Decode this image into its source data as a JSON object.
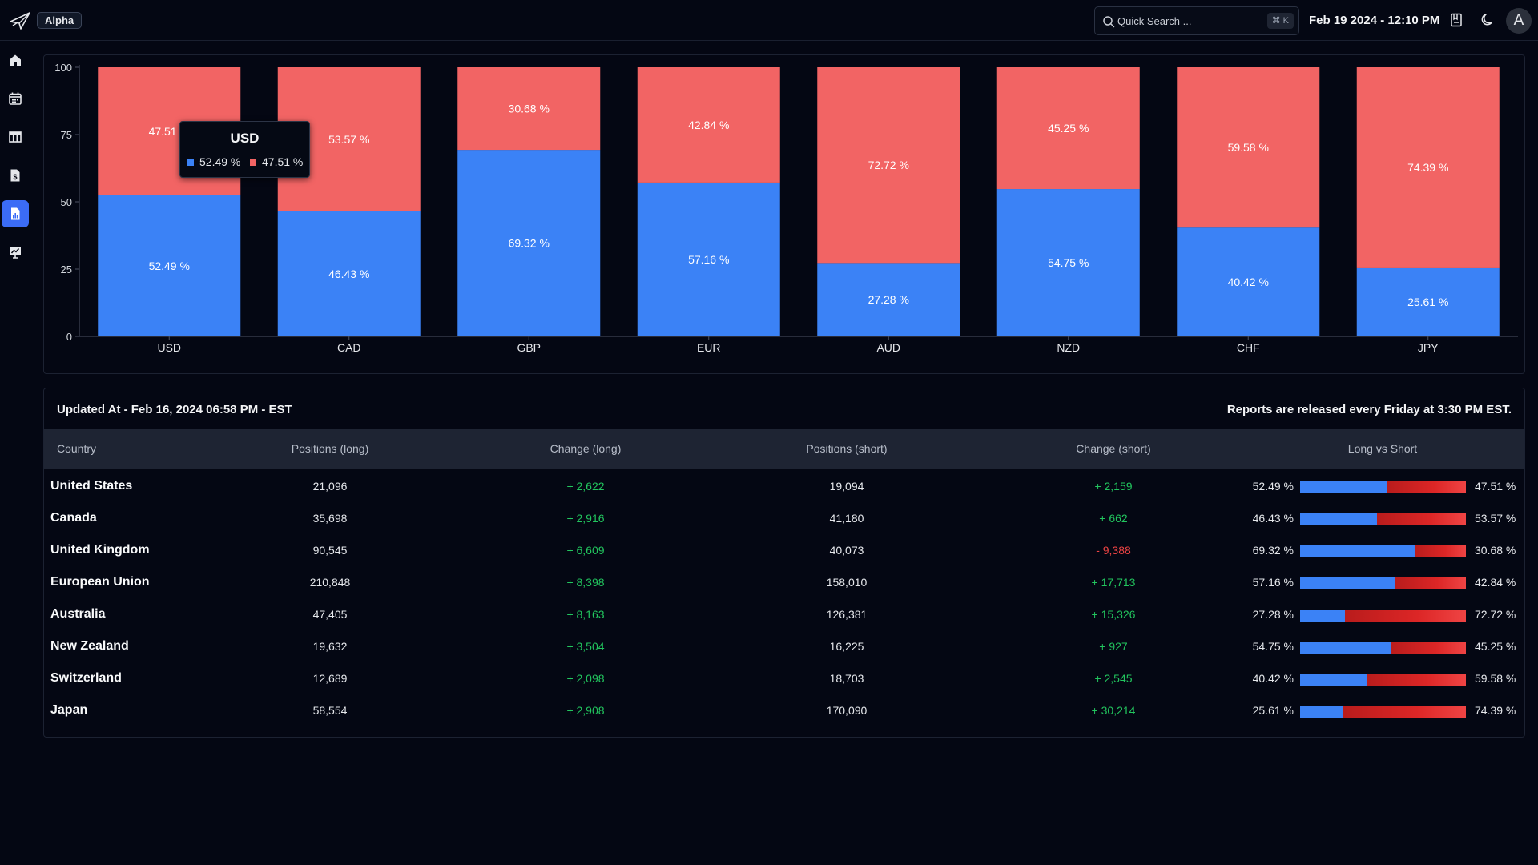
{
  "header": {
    "badge": "Alpha",
    "search_placeholder": "Quick Search ...",
    "search_shortcut": "⌘ K",
    "datetime": "Feb 19 2024 - 12:10 PM",
    "avatar_initial": "A"
  },
  "sidebar": {
    "items": [
      {
        "icon": "home-icon",
        "active": false
      },
      {
        "icon": "calendar-icon",
        "active": false
      },
      {
        "icon": "table-icon",
        "active": false
      },
      {
        "icon": "dollar-document-icon",
        "active": false
      },
      {
        "icon": "report-chart-icon",
        "active": true
      },
      {
        "icon": "chart-board-icon",
        "active": false
      }
    ]
  },
  "colors": {
    "long": "#3b82f6",
    "short": "#f26464",
    "positive": "#22c55e",
    "negative": "#ef4444",
    "active_nav": "#3b6cf6"
  },
  "chart_data": {
    "type": "bar",
    "stacked": true,
    "categories": [
      "USD",
      "CAD",
      "GBP",
      "EUR",
      "AUD",
      "NZD",
      "CHF",
      "JPY"
    ],
    "series": [
      {
        "values": [
          52.49,
          46.43,
          69.32,
          57.16,
          27.28,
          54.75,
          40.42,
          25.61
        ],
        "color": "#3b82f6"
      },
      {
        "values": [
          47.51,
          53.57,
          30.68,
          42.84,
          72.72,
          45.25,
          59.58,
          74.39
        ],
        "color": "#f26464"
      }
    ],
    "value_suffix": " %",
    "ylim": [
      0,
      100
    ],
    "yticks": [
      0,
      25,
      50,
      75,
      100
    ],
    "grid": false,
    "tooltip": {
      "title": "USD",
      "long": "52.49 %",
      "short": "47.51 %"
    }
  },
  "table": {
    "updated": "Updated At - Feb 16, 2024 06:58 PM - EST",
    "released": "Reports are released every Friday at 3:30 PM EST.",
    "headers": [
      "Country",
      "Positions (long)",
      "Change (long)",
      "Positions (short)",
      "Change (short)",
      "Long vs Short"
    ],
    "rows": [
      {
        "country": "United States",
        "pos_long": "21,096",
        "chg_long": "+ 2,622",
        "pos_short": "19,094",
        "chg_short": "+ 2,159",
        "pct_long": "52.49 %",
        "pct_short": "47.51 %",
        "long_share": 52.49
      },
      {
        "country": "Canada",
        "pos_long": "35,698",
        "chg_long": "+ 2,916",
        "pos_short": "41,180",
        "chg_short": "+ 662",
        "pct_long": "46.43 %",
        "pct_short": "53.57 %",
        "long_share": 46.43
      },
      {
        "country": "United Kingdom",
        "pos_long": "90,545",
        "chg_long": "+ 6,609",
        "pos_short": "40,073",
        "chg_short": "- 9,388",
        "pct_long": "69.32 %",
        "pct_short": "30.68 %",
        "long_share": 69.32
      },
      {
        "country": "European Union",
        "pos_long": "210,848",
        "chg_long": "+ 8,398",
        "pos_short": "158,010",
        "chg_short": "+ 17,713",
        "pct_long": "57.16 %",
        "pct_short": "42.84 %",
        "long_share": 57.16
      },
      {
        "country": "Australia",
        "pos_long": "47,405",
        "chg_long": "+ 8,163",
        "pos_short": "126,381",
        "chg_short": "+ 15,326",
        "pct_long": "27.28 %",
        "pct_short": "72.72 %",
        "long_share": 27.28
      },
      {
        "country": "New Zealand",
        "pos_long": "19,632",
        "chg_long": "+ 3,504",
        "pos_short": "16,225",
        "chg_short": "+ 927",
        "pct_long": "54.75 %",
        "pct_short": "45.25 %",
        "long_share": 54.75
      },
      {
        "country": "Switzerland",
        "pos_long": "12,689",
        "chg_long": "+ 2,098",
        "pos_short": "18,703",
        "chg_short": "+ 2,545",
        "pct_long": "40.42 %",
        "pct_short": "59.58 %",
        "long_share": 40.42
      },
      {
        "country": "Japan",
        "pos_long": "58,554",
        "chg_long": "+ 2,908",
        "pos_short": "170,090",
        "chg_short": "+ 30,214",
        "pct_long": "25.61 %",
        "pct_short": "74.39 %",
        "long_share": 25.61
      }
    ]
  }
}
